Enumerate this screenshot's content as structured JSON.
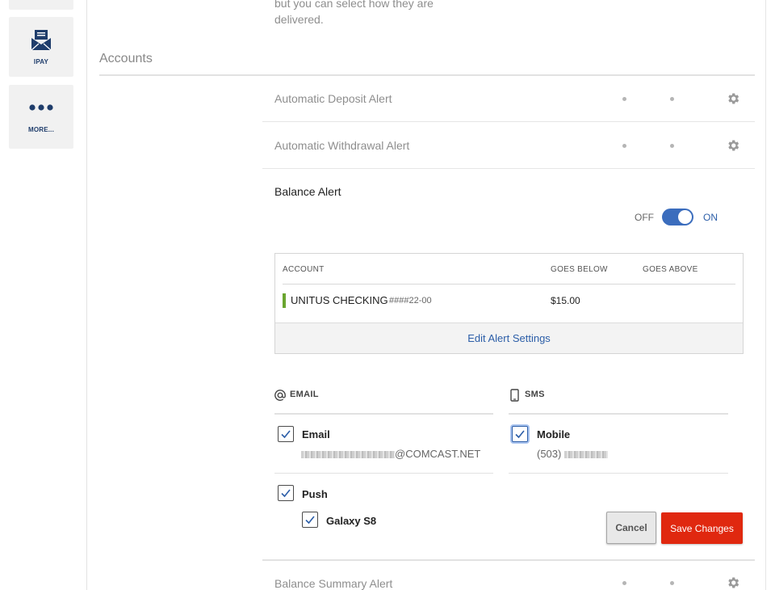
{
  "sidebar": {
    "items": [
      {
        "label": "",
        "icon": "tile-icon"
      },
      {
        "label": "IPAY",
        "icon": "envelope-icon"
      },
      {
        "label": "MORE...",
        "icon": "more-dots-icon"
      }
    ]
  },
  "intro_text": "but you can select how they are delivered.",
  "section": {
    "title": "Accounts"
  },
  "alerts": [
    {
      "name": "Automatic Deposit Alert"
    },
    {
      "name": "Automatic Withdrawal Alert"
    },
    {
      "name": "Balance Alert"
    },
    {
      "name": "Balance Summary Alert"
    }
  ],
  "toggle": {
    "off_label": "OFF",
    "on_label": "ON",
    "state": "on"
  },
  "account_table": {
    "headers": [
      "ACCOUNT",
      "GOES BELOW",
      "GOES ABOVE"
    ],
    "rows": [
      {
        "name": "UNITUS CHECKING",
        "number": "####22-00",
        "goes_below": "$15.00",
        "goes_above": "",
        "color": "#6aa52f"
      }
    ],
    "edit_label": "Edit Alert Settings"
  },
  "channels": {
    "email": {
      "heading": "EMAIL",
      "option_label": "Email",
      "address_suffix": "@COMCAST.NET",
      "push_label": "Push",
      "device_label": "Galaxy S8"
    },
    "sms": {
      "heading": "SMS",
      "option_label": "Mobile",
      "phone_prefix": "(503)"
    }
  },
  "buttons": {
    "cancel": "Cancel",
    "save": "Save Changes"
  },
  "colors": {
    "accent": "#2c5ea8",
    "save": "#e0280f",
    "toggle": "#3b6dbd",
    "account": "#6aa52f",
    "brand_navy": "#1f3d6b"
  }
}
